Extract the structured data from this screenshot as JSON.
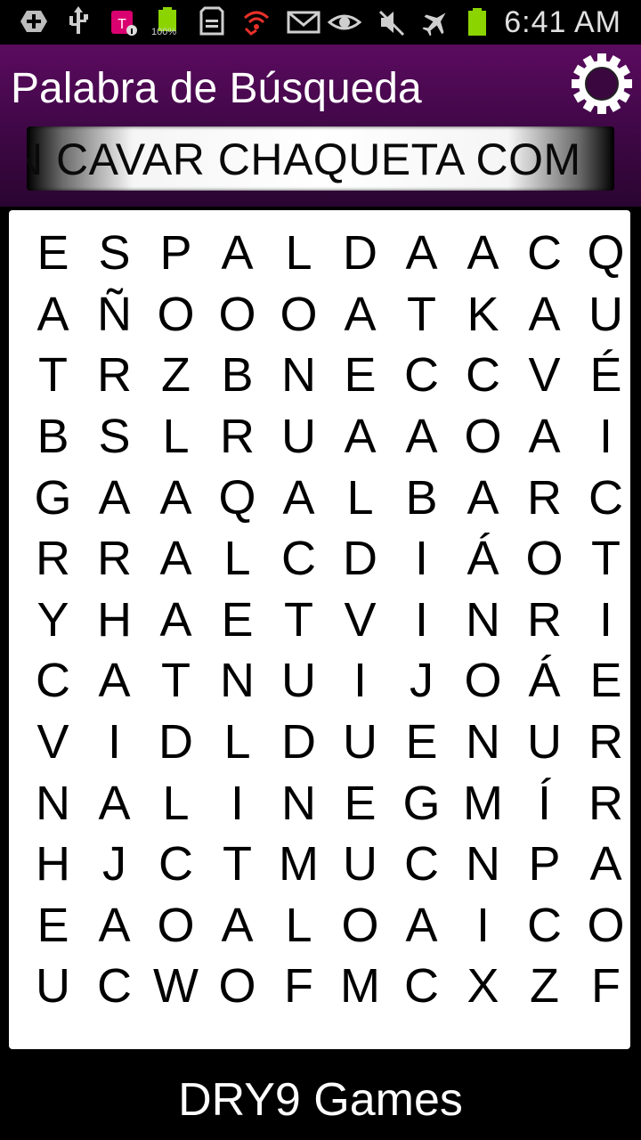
{
  "status_bar": {
    "icons_left": [
      "add-icon",
      "usb-icon",
      "tmobile-icon",
      "battery-full-icon",
      "sd-card-icon",
      "missed-call-wifi-icon",
      "mail-icon"
    ],
    "battery_label": "100%",
    "icons_right": [
      "eye-icon",
      "mute-icon",
      "airplane-icon",
      "battery-icon"
    ],
    "time": "6:41 AM"
  },
  "header": {
    "title": "Palabra de Búsqueda",
    "ticker": "N CAVAR CHAQUETA COM"
  },
  "colors": {
    "header_purple": "#4a0a50",
    "battery_green": "#8cd400",
    "accent_red": "#e8302a"
  },
  "grid": [
    [
      "E",
      "S",
      "P",
      "A",
      "L",
      "D",
      "A",
      "A",
      "C",
      "Q"
    ],
    [
      "A",
      "Ñ",
      "O",
      "O",
      "O",
      "A",
      "T",
      "K",
      "A",
      "U"
    ],
    [
      "T",
      "R",
      "Z",
      "B",
      "N",
      "E",
      "C",
      "C",
      "V",
      "É"
    ],
    [
      "B",
      "S",
      "L",
      "R",
      "U",
      "A",
      "A",
      "O",
      "A",
      "I"
    ],
    [
      "G",
      "A",
      "A",
      "Q",
      "A",
      "L",
      "B",
      "A",
      "R",
      "C"
    ],
    [
      "R",
      "R",
      "A",
      "L",
      "C",
      "D",
      "I",
      "Á",
      "O",
      "T"
    ],
    [
      "Y",
      "H",
      "A",
      "E",
      "T",
      "V",
      "I",
      "N",
      "R",
      "I"
    ],
    [
      "C",
      "A",
      "T",
      "N",
      "U",
      "I",
      "J",
      "O",
      "Á",
      "E"
    ],
    [
      "V",
      "I",
      "D",
      "L",
      "D",
      "U",
      "E",
      "N",
      "U",
      "R"
    ],
    [
      "N",
      "A",
      "L",
      "I",
      "N",
      "E",
      "G",
      "M",
      "Í",
      "R"
    ],
    [
      "H",
      "J",
      "C",
      "T",
      "M",
      "U",
      "C",
      "N",
      "P",
      "A"
    ],
    [
      "E",
      "A",
      "O",
      "A",
      "L",
      "O",
      "A",
      "I",
      "C",
      "O"
    ],
    [
      "U",
      "C",
      "W",
      "O",
      "F",
      "M",
      "C",
      "X",
      "Z",
      "F"
    ]
  ],
  "footer": {
    "brand": "DRY9 Games"
  }
}
